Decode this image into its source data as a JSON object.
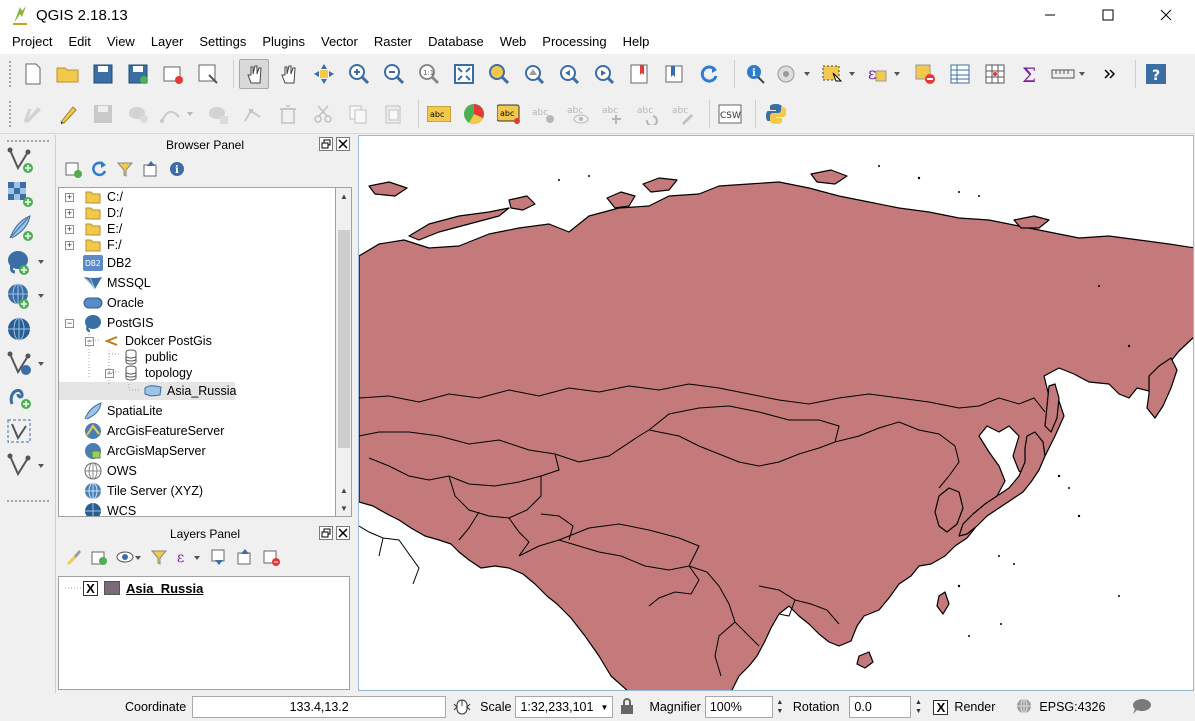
{
  "window": {
    "title": "QGIS 2.18.13",
    "controls": [
      "minimize",
      "maximize",
      "close"
    ]
  },
  "menubar": {
    "items": [
      "Project",
      "Edit",
      "View",
      "Layer",
      "Settings",
      "Plugins",
      "Vector",
      "Raster",
      "Database",
      "Web",
      "Processing",
      "Help"
    ]
  },
  "toolbar2": {
    "abc_label": "abc",
    "csw_label": "CSW"
  },
  "browser_panel": {
    "title": "Browser Panel",
    "items": [
      {
        "label": "C:/",
        "icon": "folder-icon"
      },
      {
        "label": "D:/",
        "icon": "folder-icon"
      },
      {
        "label": "E:/",
        "icon": "folder-icon"
      },
      {
        "label": "F:/",
        "icon": "folder-icon"
      },
      {
        "label": "DB2",
        "icon": "db2-icon"
      },
      {
        "label": "MSSQL",
        "icon": "mssql-icon"
      },
      {
        "label": "Oracle",
        "icon": "oracle-icon"
      },
      {
        "label": "PostGIS",
        "icon": "postgis-elephant-icon"
      },
      {
        "label": "Dokcer PostGis",
        "icon": "connection-icon"
      },
      {
        "label": "public",
        "icon": "schema-icon"
      },
      {
        "label": "topology",
        "icon": "schema-icon"
      },
      {
        "label": "Asia_Russia",
        "icon": "polygon-layer-icon"
      },
      {
        "label": "SpatiaLite",
        "icon": "spatialite-feather-icon"
      },
      {
        "label": "ArcGisFeatureServer",
        "icon": "arcgis-feature-icon"
      },
      {
        "label": "ArcGisMapServer",
        "icon": "arcgis-map-icon"
      },
      {
        "label": "OWS",
        "icon": "ows-globe-icon"
      },
      {
        "label": "Tile Server (XYZ)",
        "icon": "tile-globe-icon"
      },
      {
        "label": "WCS",
        "icon": "wcs-globe-icon"
      }
    ],
    "db2_badge": "DB2"
  },
  "layers_panel": {
    "title": "Layers Panel",
    "layers": [
      {
        "name": "Asia_Russia",
        "checked": "X",
        "color": "#7d6a78"
      }
    ]
  },
  "map": {
    "fill_color": "#c47a7a"
  },
  "statusbar": {
    "coordinate_label": "Coordinate",
    "coordinate_value": "133.4,13.2",
    "scale_label": "Scale",
    "scale_value": "1:32,233,101",
    "magnifier_label": "Magnifier",
    "magnifier_value": "100%",
    "rotation_label": "Rotation",
    "rotation_value": "0.0",
    "render_label": "Render",
    "render_checked": "X",
    "crs_value": "EPSG:4326"
  }
}
